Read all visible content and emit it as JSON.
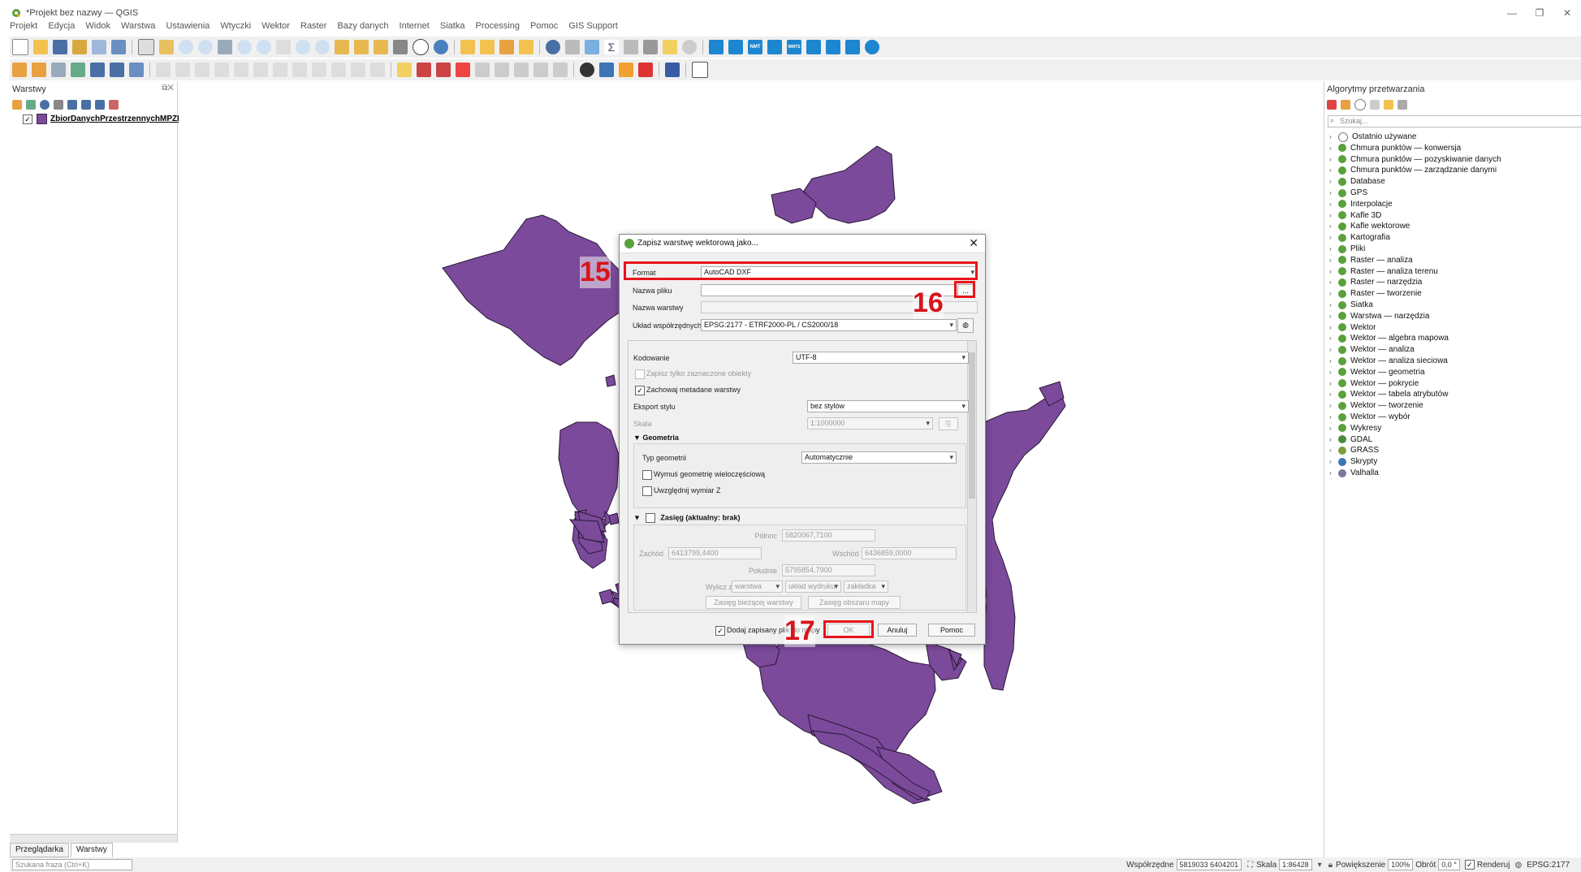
{
  "window": {
    "title": "*Projekt bez nazwy — QGIS",
    "controls": [
      "—",
      "❐",
      "✕"
    ]
  },
  "menu": [
    "Projekt",
    "Edycja",
    "Widok",
    "Warstwa",
    "Ustawienia",
    "Wtyczki",
    "Wektor",
    "Raster",
    "Bazy danych",
    "Internet",
    "Siatka",
    "Processing",
    "Pomoc",
    "GIS Support"
  ],
  "toolbar_badges": {
    "nmt": "NMT",
    "wmts": "WMTS"
  },
  "layers_panel": {
    "title": "Warstwy",
    "layer_name": "ZbiorDanychPrzestrzennychMPZP:a",
    "layer_checked": "✓",
    "tabs": [
      "Przeglądarka",
      "Warstwy"
    ]
  },
  "processing_panel": {
    "title": "Algorytmy przetwarzania",
    "search_placeholder": "Szukaj...",
    "items": [
      "Ostatnio używane",
      "Chmura punktów — konwersja",
      "Chmura punktów — pozyskiwanie danych",
      "Chmura punktów — zarządzanie danymi",
      "Database",
      "GPS",
      "Interpolacje",
      "Kafle 3D",
      "Kafle wektorowe",
      "Kartografia",
      "Pliki",
      "Raster — analiza",
      "Raster — analiza terenu",
      "Raster — narzędzia",
      "Raster — tworzenie",
      "Siatka",
      "Warstwa — narzędzia",
      "Wektor",
      "Wektor — algebra mapowa",
      "Wektor — analiza",
      "Wektor — analiza sieciowa",
      "Wektor — geometria",
      "Wektor — pokrycie",
      "Wektor — tabela atrybutów",
      "Wektor — tworzenie",
      "Wektor — wybór",
      "Wykresy",
      "GDAL",
      "GRASS",
      "Skrypty",
      "Valhalla"
    ]
  },
  "dialog": {
    "title": "Zapisz warstwę wektorową jako...",
    "format_label": "Format",
    "format_value": "AutoCAD DXF",
    "filename_label": "Nazwa pliku",
    "filename_value": "",
    "browse_label": "...",
    "layername_label": "Nazwa warstwy",
    "crs_label": "Układ współrzędnych",
    "crs_value": "EPSG:2177 - ETRF2000-PL / CS2000/18",
    "encoding_label": "Kodowanie",
    "encoding_value": "UTF-8",
    "only_selected_label": "Zapisz tylko zaznaczone obiekty",
    "keep_metadata_label": "Zachowaj metadane warstwy",
    "keep_metadata_check": "✓",
    "style_export_label": "Eksport stylu",
    "style_export_value": "bez stylów",
    "scale_label": "Skala",
    "scale_value": "1:1000000",
    "geometry_section": "Geometria",
    "geom_type_label": "Typ geometrii",
    "geom_type_value": "Automatycznie",
    "force_multi_label": "Wymuś geometrię wieloczęściową",
    "include_z_label": "Uwzględnij wymiar Z",
    "extent_section": "Zasięg (aktualny: brak)",
    "north_label": "Północ",
    "north_value": "5820067,7100",
    "west_label": "Zachód",
    "west_value": "6413799,4400",
    "east_label": "Wschód",
    "east_value": "6436859,0000",
    "south_label": "Południe",
    "south_value": "5795854,7900",
    "calc_from_label": "Wylicz z",
    "calc_layer": "warstwa",
    "calc_layout": "układ wydruku",
    "calc_bookmark": "zakładka",
    "btn_layer_extent": "Zasięg bieżącej warstwy",
    "btn_map_extent": "Zasięg obszaru mapy",
    "add_to_map_label": "Dodaj zapisany plik do mapy",
    "add_to_map_check": "✓",
    "ok": "OK",
    "cancel": "Anuluj",
    "help": "Pomoc"
  },
  "annotations": {
    "n15": "15",
    "n16": "16",
    "n17": "17"
  },
  "statusbar": {
    "search_placeholder": "Szukana fraza (Ctrl+K)",
    "coord_label": "Współrzędne",
    "coord_value": "5819033  6404201",
    "scale_label": "Skala",
    "scale_value": "1:86428",
    "magnifier_label": "Powiększenie",
    "magnifier_value": "100%",
    "rotation_label": "Obrót",
    "rotation_value": "0,0 °",
    "render_label": "Renderuj",
    "render_check": "✓",
    "crs": "EPSG:2177"
  },
  "colors": {
    "polygon_fill": "#7b4a9a",
    "polygon_stroke": "#2a1838",
    "annotation_red": "#e8141b"
  }
}
